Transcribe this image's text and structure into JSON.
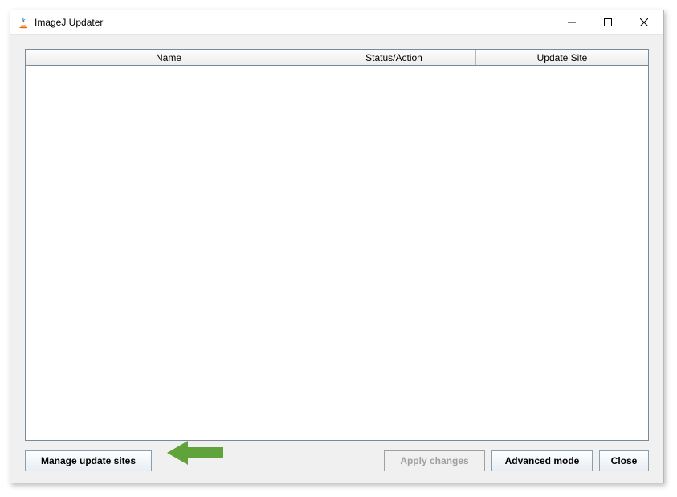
{
  "window": {
    "title": "ImageJ Updater"
  },
  "table": {
    "headers": {
      "name": "Name",
      "status": "Status/Action",
      "site": "Update Site"
    }
  },
  "buttons": {
    "manage": "Manage update sites",
    "apply": "Apply changes",
    "advanced": "Advanced mode",
    "close": "Close"
  }
}
